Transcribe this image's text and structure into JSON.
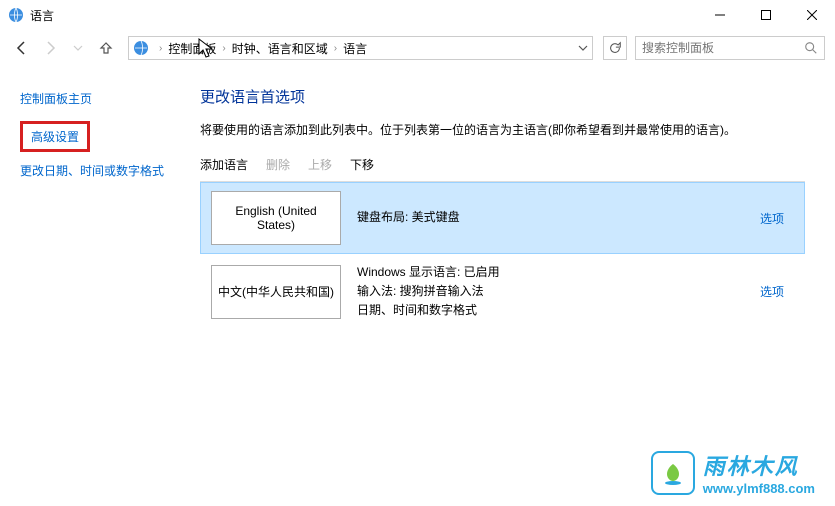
{
  "window": {
    "title": "语言"
  },
  "breadcrumb": {
    "items": [
      "控制面板",
      "时钟、语言和区域",
      "语言"
    ]
  },
  "search": {
    "placeholder": "搜索控制面板"
  },
  "sidebar": {
    "home": "控制面板主页",
    "advanced": "高级设置",
    "datefmt": "更改日期、时间或数字格式"
  },
  "main": {
    "heading": "更改语言首选项",
    "desc": "将要使用的语言添加到此列表中。位于列表第一位的语言为主语言(即你希望看到并最常使用的语言)。"
  },
  "toolbar": {
    "add": "添加语言",
    "remove": "删除",
    "up": "上移",
    "down": "下移"
  },
  "languages": [
    {
      "name": "English (United States)",
      "info_lines": [
        "键盘布局: 美式键盘"
      ],
      "options": "选项",
      "selected": true
    },
    {
      "name": "中文(中华人民共和国)",
      "info_lines": [
        "Windows 显示语言: 已启用",
        "输入法: 搜狗拼音输入法",
        "日期、时间和数字格式"
      ],
      "options": "选项",
      "selected": false
    }
  ],
  "watermark": {
    "title": "雨林木风",
    "url": "www.ylmf888.com"
  }
}
